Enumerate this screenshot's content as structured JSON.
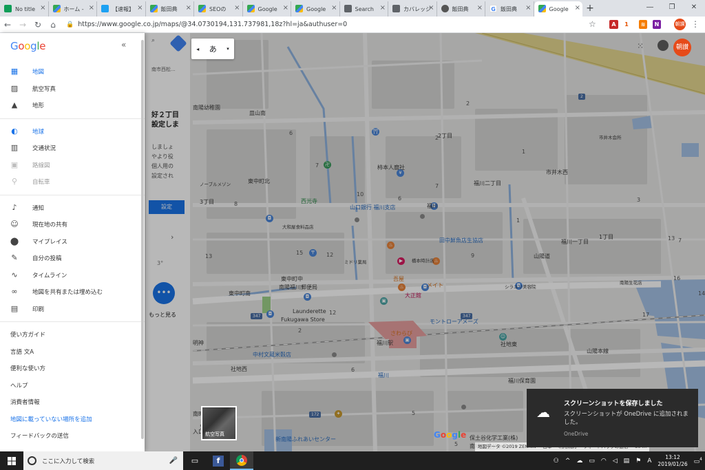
{
  "browser": {
    "tabs": [
      {
        "title": "No title",
        "icon": "green"
      },
      {
        "title": "ホーム -",
        "icon": "maps"
      },
      {
        "title": "【速報】",
        "icon": "bird"
      },
      {
        "title": "飯田典",
        "icon": "maps"
      },
      {
        "title": "SEOの",
        "icon": "maps"
      },
      {
        "title": "Google",
        "icon": "maps"
      },
      {
        "title": "Google",
        "icon": "maps"
      },
      {
        "title": "Search",
        "icon": "gray"
      },
      {
        "title": "カバレッジ",
        "icon": "gray"
      },
      {
        "title": "飯田典",
        "icon": "circle"
      },
      {
        "title": "飯田典",
        "icon": "g"
      },
      {
        "title": "Google",
        "icon": "maps",
        "active": true
      }
    ],
    "url": "https://www.google.co.jp/maps/@34.0730194,131.737981,18z?hl=ja&authuser=0",
    "profile_initials": "朝讃",
    "ext_badge": "1"
  },
  "sidebar": {
    "logo": "Google",
    "layers": [
      {
        "label": "地図",
        "icon": "map-icon",
        "glyph": "▦",
        "active": true
      },
      {
        "label": "航空写真",
        "icon": "satellite-icon",
        "glyph": "▨"
      },
      {
        "label": "地形",
        "icon": "terrain-icon",
        "glyph": "▲"
      }
    ],
    "overlays": [
      {
        "label": "地球",
        "icon": "globe-icon",
        "glyph": "◐",
        "active": true
      },
      {
        "label": "交通状況",
        "icon": "traffic-icon",
        "glyph": "▥"
      },
      {
        "label": "路線図",
        "icon": "train-icon",
        "glyph": "▣",
        "disabled": true
      },
      {
        "label": "自転車",
        "icon": "bike-icon",
        "glyph": "⚲",
        "disabled": true
      }
    ],
    "actions": [
      {
        "label": "通知",
        "icon": "bell-icon",
        "glyph": "♪"
      },
      {
        "label": "現在地の共有",
        "icon": "share-location-icon",
        "glyph": "☺"
      },
      {
        "label": "マイプレイス",
        "icon": "place-icon",
        "glyph": "⬤"
      },
      {
        "label": "自分の投稿",
        "icon": "edit-icon",
        "glyph": "✎"
      },
      {
        "label": "タイムライン",
        "icon": "timeline-icon",
        "glyph": "∿"
      },
      {
        "label": "地図を共有または埋め込む",
        "icon": "link-icon",
        "glyph": "∞"
      },
      {
        "label": "印刷",
        "icon": "print-icon",
        "glyph": "▤"
      }
    ],
    "links": [
      {
        "label": "使い方ガイド"
      },
      {
        "label": "言語 文A"
      },
      {
        "label": "便利な使い方"
      },
      {
        "label": "ヘルプ"
      },
      {
        "label": "消費者情報"
      },
      {
        "label": "地図に載っていない場所を追加",
        "blue": true
      },
      {
        "label": "フィードバックの送信"
      }
    ]
  },
  "behind_panel": {
    "search_text": "南市西松...",
    "heading1": "好２丁目",
    "heading2": "設定しま",
    "body1": "しましょ",
    "body2": "やより役",
    "body3": "個人用の",
    "body4": "設定され",
    "button": "設定",
    "weather": "3°",
    "more": "もっと見る"
  },
  "map": {
    "input_mode": "あ",
    "avatar": "朝讃",
    "satellite_label": "航空写真",
    "logo": "Google",
    "attribution": [
      "地図データ ©2019 ZENRIN",
      "日本",
      "利用規約",
      "フィードバックの送信",
      "50 m"
    ],
    "labels": [
      {
        "t": "南陽幼稚園",
        "cls": ""
      },
      {
        "t": "皿山南",
        "cls": ""
      },
      {
        "t": "柿本人麿社",
        "cls": ""
      },
      {
        "t": "2丁目",
        "cls": ""
      },
      {
        "t": "市井木会所",
        "cls": "small"
      },
      {
        "t": "市井木西",
        "cls": ""
      },
      {
        "t": "東中町北",
        "cls": ""
      },
      {
        "t": "ノーブルメゾン",
        "cls": "small"
      },
      {
        "t": "福川二丁目",
        "cls": ""
      },
      {
        "t": "3丁目",
        "cls": ""
      },
      {
        "t": "西光寺",
        "cls": "green"
      },
      {
        "t": "山口銀行 福川支店",
        "cls": "blue"
      },
      {
        "t": "福川",
        "cls": ""
      },
      {
        "t": "大和屋食料品店",
        "cls": "small"
      },
      {
        "t": "田中鮮魚店生協店",
        "cls": "blue"
      },
      {
        "t": "福川一丁目",
        "cls": ""
      },
      {
        "t": "1丁目",
        "cls": ""
      },
      {
        "t": "ミドリ薬局",
        "cls": "small"
      },
      {
        "t": "橋本時計店",
        "cls": "small"
      },
      {
        "t": "山陽道",
        "cls": ""
      },
      {
        "t": "東中町中",
        "cls": ""
      },
      {
        "t": "南陽福川郵便局",
        "cls": ""
      },
      {
        "t": "吾屋",
        "cls": "orange"
      },
      {
        "t": "メイト",
        "cls": "orange"
      },
      {
        "t": "シラユリ美容院",
        "cls": "small"
      },
      {
        "t": "南陽生花店",
        "cls": "small"
      },
      {
        "t": "東中町南",
        "cls": ""
      },
      {
        "t": "大正館",
        "cls": "pink"
      },
      {
        "t": "Launderette",
        "cls": ""
      },
      {
        "t": "Fukugawa Store",
        "cls": ""
      },
      {
        "t": "モントローアメーズ",
        "cls": "blue"
      },
      {
        "t": "さわらび",
        "cls": "orange"
      },
      {
        "t": "明神",
        "cls": ""
      },
      {
        "t": "福川駅",
        "cls": ""
      },
      {
        "t": "社地東",
        "cls": ""
      },
      {
        "t": "中村文蔵米穀店",
        "cls": "blue"
      },
      {
        "t": "山陽本線",
        "cls": ""
      },
      {
        "t": "社地西",
        "cls": ""
      },
      {
        "t": "福川保育園",
        "cls": ""
      },
      {
        "t": "福川",
        "cls": "blue"
      },
      {
        "t": "南町",
        "cls": ""
      },
      {
        "t": "保土谷化学工業(株)",
        "cls": ""
      },
      {
        "t": "南陽工場ジャスパー",
        "cls": ""
      },
      {
        "t": "新南陽ふれあいセンター",
        "cls": "blue"
      },
      {
        "t": "入口",
        "cls": ""
      }
    ],
    "numbers": [
      "2",
      "6",
      "7",
      "2",
      "1",
      "10",
      "6",
      "8",
      "7",
      "12",
      "13",
      "15",
      "9",
      "16",
      "13",
      "14",
      "12",
      "2",
      "17",
      "7",
      "6",
      "1",
      "5",
      "5",
      "3",
      "5"
    ],
    "route_shields": [
      "347",
      "347",
      "172",
      "172",
      "2"
    ]
  },
  "toast": {
    "title": "スクリーンショットを保存しました",
    "body": "スクリーンショットが OneDrive に追加されました。",
    "source": "OneDrive"
  },
  "taskbar": {
    "search_placeholder": "ここに入力して検索",
    "time": "13:12",
    "date": "2019/01/26",
    "notification_count": "4"
  }
}
